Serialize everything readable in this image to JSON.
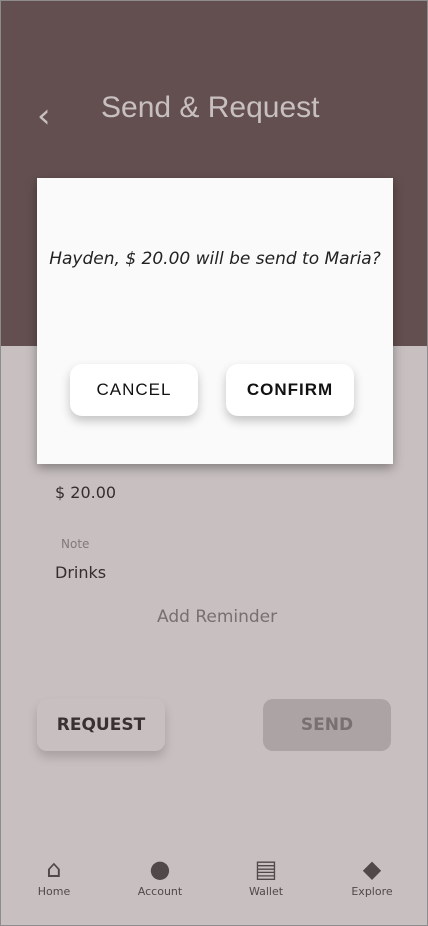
{
  "header": {
    "title": "Send & Request",
    "back_icon": "chevron-left-icon"
  },
  "form": {
    "amount_value": "$ 20.00",
    "note_label": "Note",
    "note_value": "Drinks",
    "add_reminder": "Add Reminder"
  },
  "actions": {
    "request": "REQUEST",
    "send": "SEND"
  },
  "bottom_nav": {
    "items": [
      {
        "label": "Home",
        "icon": "home-icon"
      },
      {
        "label": "Account",
        "icon": "person-icon"
      },
      {
        "label": "Wallet",
        "icon": "wallet-icon"
      },
      {
        "label": "Explore",
        "icon": "tag-icon"
      }
    ]
  },
  "dialog": {
    "message": "Hayden, $ 20.00  will be send to Maria?",
    "cancel": "CANCEL",
    "confirm": "CONFIRM"
  },
  "colors": {
    "header_bg": "#6f5d5d",
    "overlay": "rgba(72,47,47,0.30)",
    "dialog_bg": "#fafafa"
  }
}
